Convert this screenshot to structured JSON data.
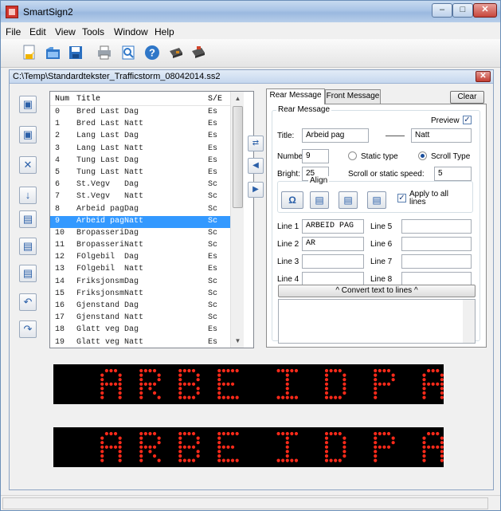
{
  "window": {
    "title": "SmartSign2",
    "controls": {
      "minimize": "–",
      "maximize": "□",
      "close": "✕"
    }
  },
  "menu": [
    "File",
    "Edit",
    "View",
    "Tools",
    "Window",
    "Help"
  ],
  "toolbar": [
    "new-icon",
    "open-folder-icon",
    "save-icon",
    "print-icon",
    "print-preview-icon",
    "help-icon",
    "send-to-sign-icon",
    "read-from-sign-icon"
  ],
  "document": {
    "path": "C:\\Temp\\Standardtekster_Trafficstorm_08042014.ss2",
    "close": "✕"
  },
  "side_buttons": [
    {
      "name": "import-button",
      "glyph": "▣"
    },
    {
      "name": "export-button",
      "glyph": "▣"
    },
    {
      "name": "delete-button",
      "glyph": "✕"
    },
    {
      "name": "sort-button",
      "glyph": "↓"
    },
    {
      "name": "edit-button",
      "glyph": "▤"
    },
    {
      "name": "copy-button",
      "glyph": "▤"
    },
    {
      "name": "paste-button",
      "glyph": "▤"
    },
    {
      "name": "undo-button",
      "glyph": "↶"
    },
    {
      "name": "redo-button",
      "glyph": "↷"
    }
  ],
  "list": {
    "headers": {
      "num": "Num",
      "title": "Title",
      "se": "S/E"
    },
    "selected_index": 9,
    "rows": [
      {
        "num": "0",
        "title": "Bred Last Dag",
        "se": "Es"
      },
      {
        "num": "1",
        "title": "Bred Last Natt",
        "se": "Es"
      },
      {
        "num": "2",
        "title": "Lang Last Dag",
        "se": "Es"
      },
      {
        "num": "3",
        "title": "Lang Last Natt",
        "se": "Es"
      },
      {
        "num": "4",
        "title": "Tung Last Dag",
        "se": "Es"
      },
      {
        "num": "5",
        "title": "Tung Last Natt",
        "se": "Es"
      },
      {
        "num": "6",
        "title": "St.Vegv   Dag",
        "se": "Sc"
      },
      {
        "num": "7",
        "title": "St.Vegv   Natt",
        "se": "Sc"
      },
      {
        "num": "8",
        "title": "Arbeid pagDag",
        "se": "Sc"
      },
      {
        "num": "9",
        "title": "Arbeid pagNatt",
        "se": "Sc"
      },
      {
        "num": "10",
        "title": "BropasseriDag",
        "se": "Sc"
      },
      {
        "num": "11",
        "title": "BropasseriNatt",
        "se": "Sc"
      },
      {
        "num": "12",
        "title": "FOlgebil  Dag",
        "se": "Es"
      },
      {
        "num": "13",
        "title": "FOlgebil  Natt",
        "se": "Es"
      },
      {
        "num": "14",
        "title": "FriksjonsmDag",
        "se": "Sc"
      },
      {
        "num": "15",
        "title": "FriksjonsmNatt",
        "se": "Sc"
      },
      {
        "num": "16",
        "title": "Gjenstand Dag",
        "se": "Sc"
      },
      {
        "num": "17",
        "title": "Gjenstand Natt",
        "se": "Sc"
      },
      {
        "num": "18",
        "title": "Glatt veg Dag",
        "se": "Es"
      },
      {
        "num": "19",
        "title": "Glatt veg Natt",
        "se": "Es"
      }
    ]
  },
  "mid_buttons": [
    {
      "name": "swap-messages-button",
      "glyph": "⇄"
    },
    {
      "name": "copy-to-rear-button",
      "glyph": "◀"
    },
    {
      "name": "copy-to-front-button",
      "glyph": "▶"
    }
  ],
  "tabs": {
    "rear": "Rear Message",
    "front": "Front Message",
    "clear": "Clear"
  },
  "editor": {
    "group_title": "Rear Message",
    "preview_label": "Preview",
    "preview_checked": true,
    "title_label": "Title:",
    "title_left": "Arbeid pag",
    "title_right": "Natt",
    "number_label": "Number",
    "number_value": "9",
    "static_type_label": "Static type",
    "scroll_type_label": "Scroll Type",
    "selected_type": "scroll",
    "bright_label": "Bright:",
    "bright_value": "25",
    "speed_label": "Scroll or static speed:",
    "speed_value": "5",
    "align_label": "Align",
    "special_char_glyph": "Ω",
    "apply_all_label": "Apply to all lines",
    "apply_all_checked": true,
    "lines": [
      {
        "label": "Line 1",
        "value": "ARBEID PAG"
      },
      {
        "label": "Line 2",
        "value": "AR"
      },
      {
        "label": "Line 3",
        "value": ""
      },
      {
        "label": "Line 4",
        "value": ""
      },
      {
        "label": "Line 5",
        "value": ""
      },
      {
        "label": "Line 6",
        "value": ""
      },
      {
        "label": "Line 7",
        "value": ""
      },
      {
        "label": "Line 8",
        "value": ""
      }
    ],
    "convert_label": "^ Convert text to lines ^"
  },
  "led_preview": {
    "color": "#ff2a1a",
    "line1": "ARBEIDPA",
    "line2": "ARBEIDPA"
  }
}
